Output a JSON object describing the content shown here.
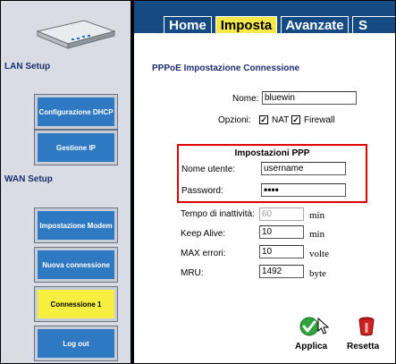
{
  "sidebar": {
    "lan_label": "LAN Setup",
    "wan_label": "WAN Setup",
    "buttons": [
      {
        "label": "Configurazione DHCP"
      },
      {
        "label": "Gestione IP"
      },
      {
        "label": "Impostazione Modem"
      },
      {
        "label": "Nuova connessione"
      },
      {
        "label": "Connessione 1"
      },
      {
        "label": "Log out"
      }
    ]
  },
  "tabs": [
    {
      "label": "Home"
    },
    {
      "label": "Imposta"
    },
    {
      "label": "Avanzate"
    },
    {
      "label": "S"
    }
  ],
  "main": {
    "title": "PPPoE Impostazione Connessione",
    "name_label": "Nome:",
    "name_value": "bluewin",
    "options_label": "Opzioni:",
    "nat_label": "NAT",
    "firewall_label": "Firewall",
    "ppp_title": "Impostazioni PPP",
    "username_label": "Nome utente:",
    "username_value": "username",
    "password_label": "Password:",
    "password_value": "••••",
    "idle_label": "Tempo di inattività:",
    "idle_value": "60",
    "idle_unit": "min",
    "keepalive_label": "Keep Alive:",
    "keepalive_value": "10",
    "keepalive_unit": "min",
    "maxerr_label": "MAX errori:",
    "maxerr_value": "10",
    "maxerr_unit": "volte",
    "mru_label": "MRU:",
    "mru_value": "1492",
    "mru_unit": "byte",
    "apply_label": "Applica",
    "reset_label": "Resetta"
  },
  "colors": {
    "tab_bar": "#154a83",
    "active_tab": "#f7e84a",
    "sidebar_button": "#2f78c2",
    "active_sidebar_button": "#f7ef3f",
    "highlight_box": "#e00000"
  }
}
